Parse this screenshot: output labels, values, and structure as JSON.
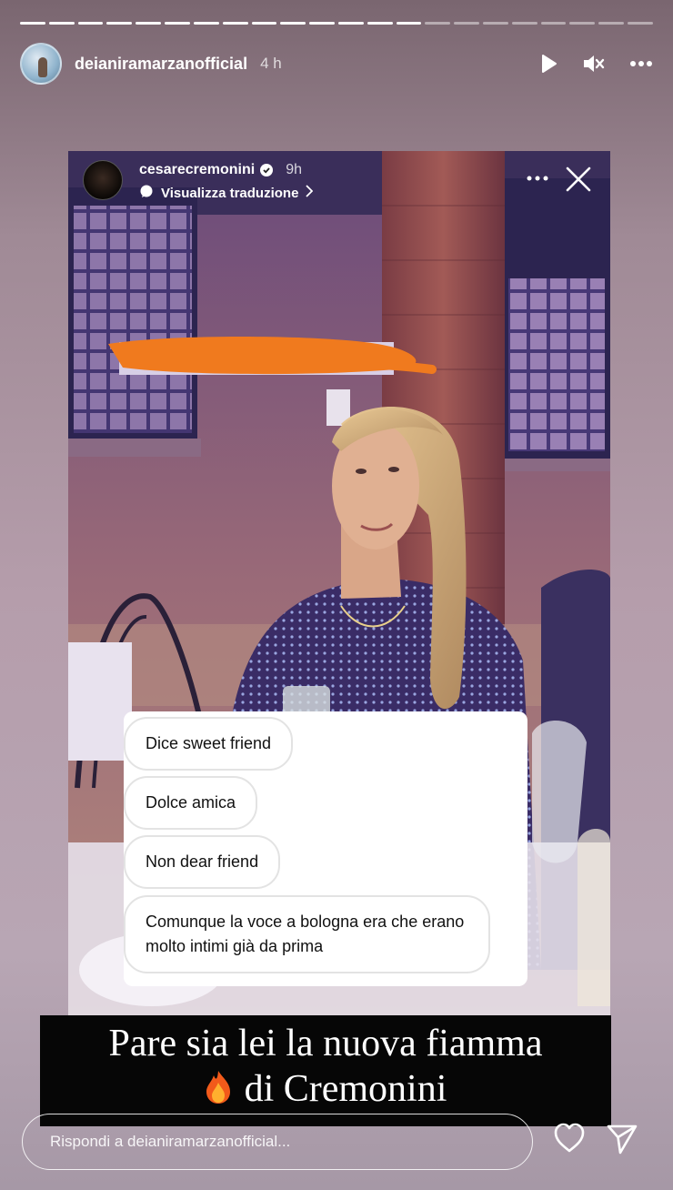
{
  "story": {
    "username": "deianiramarzanofficial",
    "time": "4 h",
    "progress_segments_total": 22,
    "progress_segments_done": 14
  },
  "header_icons": [
    "play-icon",
    "mute-icon",
    "more-icon"
  ],
  "repost": {
    "username": "cesarecremonini",
    "time": "9h",
    "translate_label": "Visualizza traduzione",
    "bubbles": [
      "Dice sweet friend",
      "Dolce amica",
      "Non dear friend",
      "Comunque la voce a bologna era che erano molto intimi già da prima"
    ]
  },
  "caption": {
    "line1": "Pare sia lei la nuova fiamma",
    "line2": "di Cremonini"
  },
  "reply": {
    "placeholder": "Rispondi a deianiramarzanofficial..."
  }
}
